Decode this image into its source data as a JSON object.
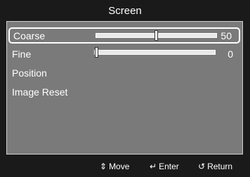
{
  "title": "Screen",
  "menu": {
    "items": [
      {
        "label": "Coarse",
        "value": "50",
        "level": 0.5,
        "selected": true
      },
      {
        "label": "Fine",
        "value": "0",
        "level": 0.0,
        "selected": false
      },
      {
        "label": "Position"
      },
      {
        "label": "Image Reset"
      }
    ]
  },
  "footer": {
    "move": {
      "icon": "updown-arrows-icon",
      "glyph": "⇕",
      "label": "Move"
    },
    "enter": {
      "icon": "enter-icon",
      "glyph": "↵",
      "label": "Enter"
    },
    "return": {
      "icon": "return-icon",
      "glyph": "↺",
      "label": "Return"
    }
  },
  "colors": {
    "panel": "#7a7a7a",
    "background": "#1a1a1a",
    "text": "#ffffff"
  }
}
